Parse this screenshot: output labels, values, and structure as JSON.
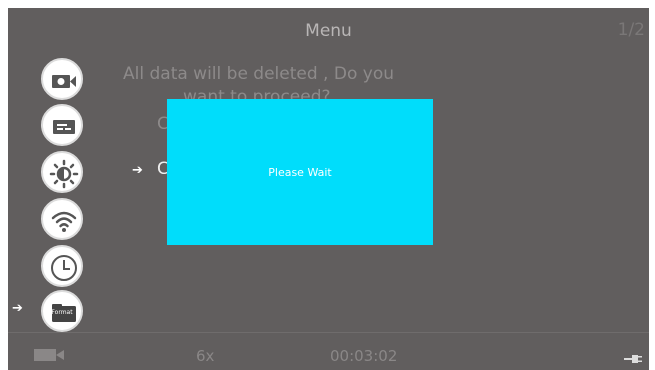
{
  "header": {
    "title": "Menu",
    "page_indicator": "1/2"
  },
  "side_menu": {
    "items": [
      {
        "icon": "video-camera-icon"
      },
      {
        "icon": "display-icon"
      },
      {
        "icon": "brightness-icon"
      },
      {
        "icon": "wifi-icon"
      },
      {
        "icon": "clock-icon"
      },
      {
        "icon": "format-icon",
        "label": "Format",
        "selected": true
      }
    ]
  },
  "content": {
    "prompt_line1": "All data will be deleted , Do you",
    "prompt_line2": "want to proceed?",
    "option1": "C",
    "option2": "C",
    "selected_option": 2
  },
  "dialog": {
    "message": "Please Wait"
  },
  "status_bar": {
    "mode_icon": "video-camera-icon",
    "zoom": "6x",
    "timer": "00:03:02",
    "power_icon": "power-plug-icon"
  },
  "colors": {
    "background": "#615e5e",
    "dialog": "#00ddfb",
    "dim_text": "#8d8a8a",
    "bright_text": "#ffffff"
  }
}
